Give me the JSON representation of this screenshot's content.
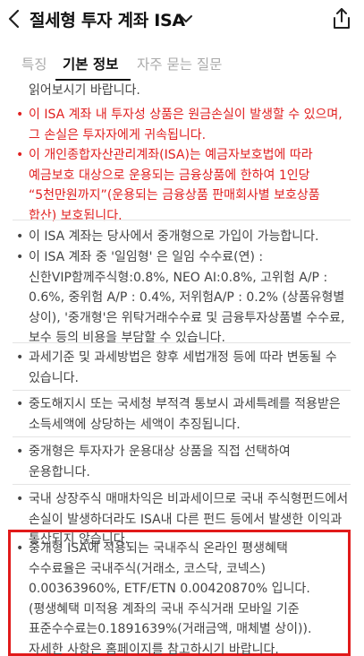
{
  "header": {
    "title": "절세형 투자 계좌 ISA",
    "back_icon": "chevron-left-icon",
    "dropdown_icon": "chevron-down-icon",
    "share_icon": "share-icon"
  },
  "tabs": [
    {
      "label": "특징",
      "active": false
    },
    {
      "label": "기본 정보",
      "active": true
    },
    {
      "label": "자주 묻는 질문",
      "active": false
    }
  ],
  "content": {
    "intro_tail": "읽어보시기 바랍니다.",
    "warnings": [
      "이 ISA 계좌 내 투자성 상품은 원금손실이 발생할 수 있으며, 그 손실은 투자자에게 귀속됩니다.",
      "이 개인종합자산관리계좌(ISA)는 예금자보호법에 따라 예금보호 대상으로 운용되는 금융상품에 한하여 1인당 “5천만원까지”(운용되는 금융상품 판매회사별 보호상품 합산) 보호됩니다."
    ],
    "notes": [
      "이 ISA 계좌는 당사에서 중개형으로 가입이 가능합니다.",
      "이 ISA 계좌 중 '일임형' 은 일임 수수료(연) : 신한VIP함께주식형:0.8%, NEO AI:0.8%, 고위험 A/P : 0.6%, 중위험 A/P : 0.4%, 저위험A/P : 0.2% (상품유형별 상이), '중개형'은 위탁거래수수료 및 금융투자상품별 수수료, 보수 등의 비용을 부담할 수 있습니다.",
      "과세기준 및 과세방법은 향후 세법개정 등에 따라 변동될 수 있습니다.",
      "중도해지시 또는 국세청 부적격 통보시 과세특례를 적용받은 소득세액에 상당하는 세액이 추징됩니다.",
      "중개형은 투자자가 운용대상 상품을 직접 선택하여 운용합니다.",
      "국내 상장주식 매매차익은 비과세이므로 국내 주식형펀드에서 손실이 발생하더라도 ISA내 다른 펀드 등에서 발생한 이익과 통산되지 않습니다.",
      "중개형 ISA에 적용되는 국내주식 온라인 평생혜택 수수료율은 국내주식(거래소, 코스닥, 코넥스) 0.00363960%, ETF/ETN 0.00420870% 입니다.(평생혜택 미적용 계좌의 국내 주식거래 모바일 기준 표준수수료는0.1891639%(거래금액, 매체별 상이)). 자세한 사항은 홈페이지를 참고하시기 바랍니다."
    ],
    "bullet": "•",
    "colors": {
      "warning": "#e02020",
      "highlight_border": "#e11a1a"
    }
  }
}
